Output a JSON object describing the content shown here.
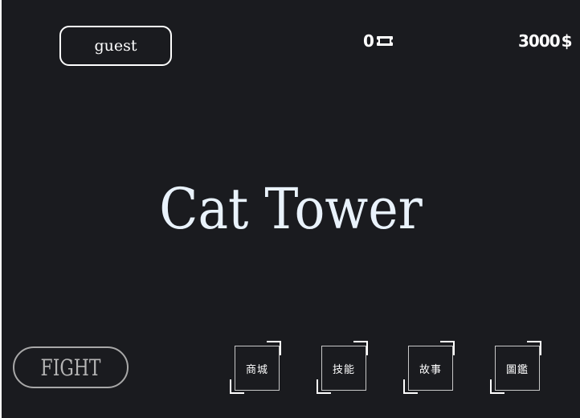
{
  "user": {
    "name": "guest"
  },
  "currency": {
    "tickets": "0",
    "ticket_icon": "ticket-icon",
    "coins": "3000",
    "coin_icon": "dollar-icon",
    "coin_symbol": "$"
  },
  "title": "Cat Tower",
  "fight_button": {
    "label": "FIGHT"
  },
  "menu": [
    {
      "label": "商城"
    },
    {
      "label": "技能"
    },
    {
      "label": "故事"
    },
    {
      "label": "圖鑑"
    }
  ],
  "colors": {
    "background": "#1a1b1f",
    "title": "#e9f2fb",
    "fight": "#b5b5b5"
  }
}
